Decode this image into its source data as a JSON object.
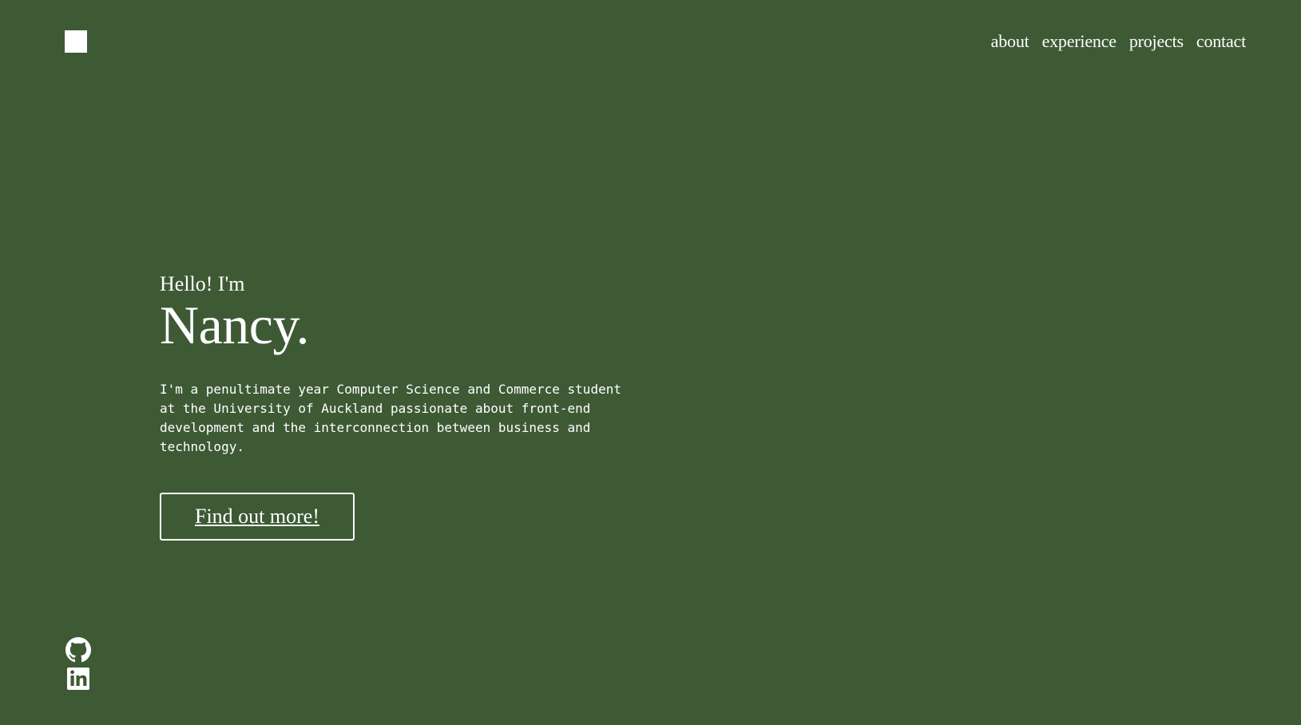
{
  "colors": {
    "background": "#3d5a35",
    "foreground": "#ffffff"
  },
  "header": {
    "logo_icon": "square-logo-icon",
    "nav": [
      {
        "label": "about"
      },
      {
        "label": "experience"
      },
      {
        "label": "projects"
      },
      {
        "label": "contact"
      }
    ]
  },
  "hero": {
    "greeting": "Hello! I'm",
    "name": "Nancy.",
    "description": "I'm a penultimate year Computer Science and Commerce student at the University of Auckland passionate about front-end development and the interconnection between business and technology.",
    "cta_label": "Find out more!"
  },
  "socials": [
    {
      "icon": "github-icon"
    },
    {
      "icon": "linkedin-icon"
    }
  ]
}
